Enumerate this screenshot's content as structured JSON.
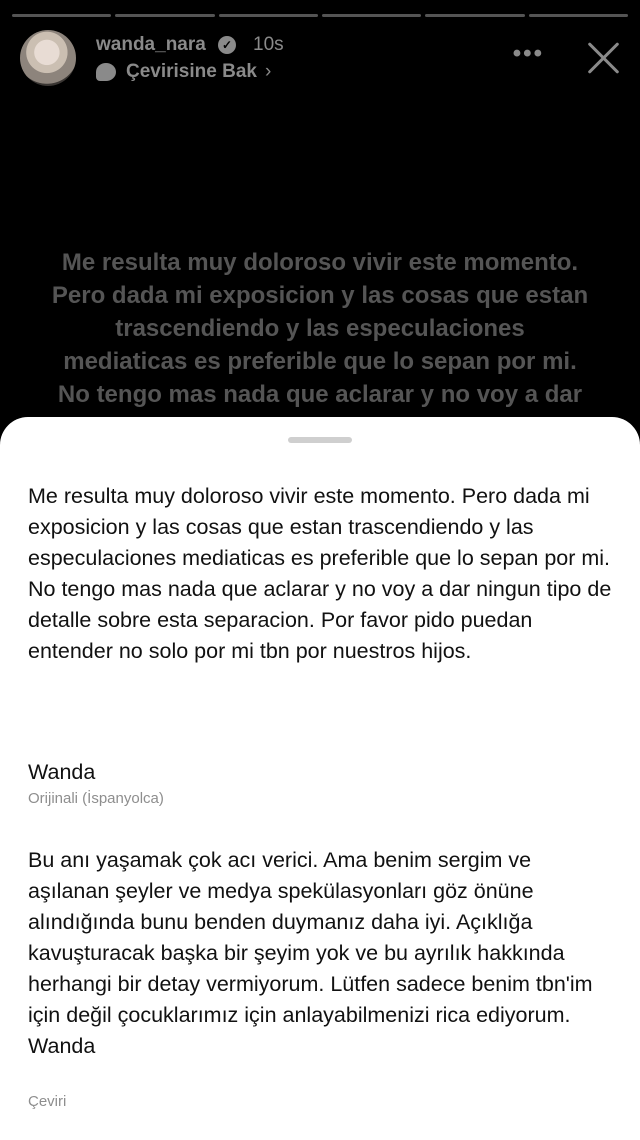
{
  "story": {
    "progress_segments": 6,
    "username": "wanda_nara",
    "time": "10s",
    "translate_link": "Çevirisine Bak",
    "more_glyph": "•••",
    "text": "Me resulta muy doloroso  vivir este momento.\nPero dada mi exposicion y las cosas que estan\ntrascendiendo y las especulaciones\nmediaticas es preferible que lo sepan por mi.\nNo tengo  mas nada que aclarar y no voy a dar"
  },
  "sheet": {
    "original_text": "Me resulta muy doloroso  vivir este momento. Pero dada mi exposicion y las cosas que estan trascendiendo y las especulaciones mediaticas es preferible que lo sepan por mi. No tengo  mas nada que aclarar y no voy a dar ningun tipo de detalle sobre esta separacion. Por favor pido puedan entender no solo por mi  tbn por nuestros hijos.",
    "signature": "Wanda",
    "original_label": "Orijinali (İspanyolca)",
    "translation_text": "Bu anı yaşamak çok acı verici. Ama benim sergim ve aşılanan şeyler ve medya spekülasyonları göz önüne alındığında bunu benden duymanız daha iyi. Açıklığa kavuşturacak başka bir şeyim yok ve bu ayrılık hakkında herhangi bir detay vermiyorum. Lütfen sadece benim tbn'im için değil çocuklarımız için anlayabilmenizi rica ediyorum. Wanda",
    "translation_label": "Çeviri"
  },
  "icons": [
    "avatar",
    "verified-badge-icon",
    "translate-bubble-icon",
    "chevron-right-icon",
    "more-icon",
    "close-icon",
    "sheet-handle"
  ],
  "colors": {
    "background": "#000000",
    "sheet": "#ffffff",
    "muted": "#8a8a8a",
    "story_text": "#555555"
  }
}
